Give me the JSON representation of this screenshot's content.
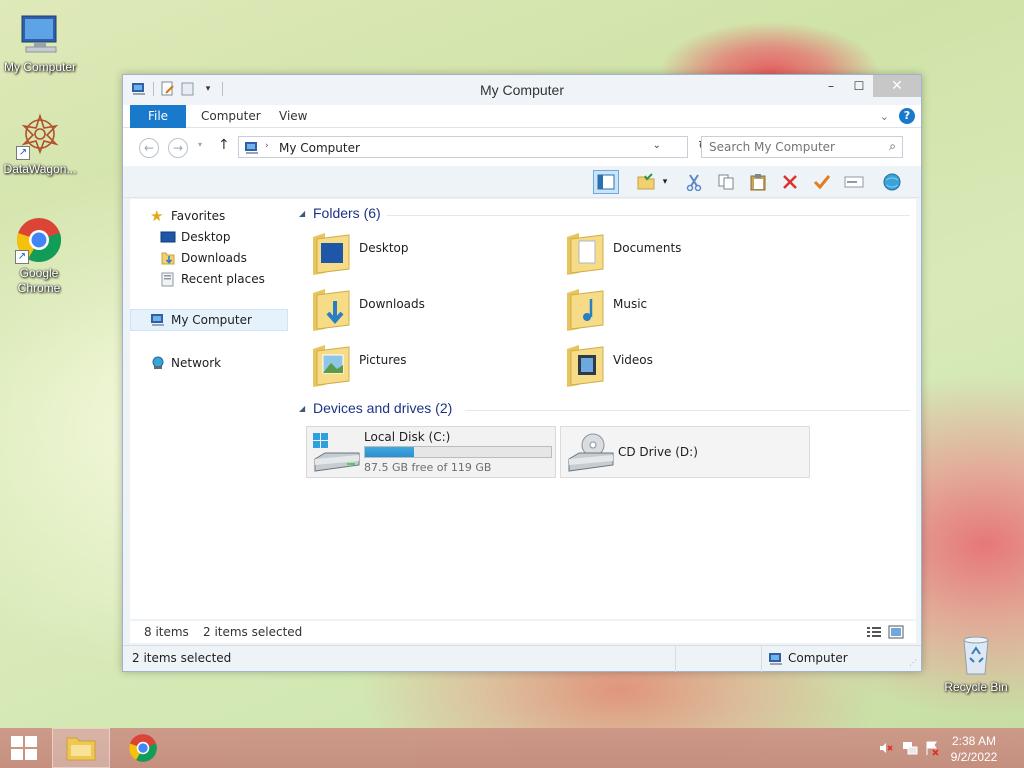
{
  "desktop": {
    "icons": [
      {
        "label": "My Computer"
      },
      {
        "label": "DataWagon..."
      },
      {
        "label": "Google Chrome"
      },
      {
        "label": "Recycle Bin"
      }
    ]
  },
  "window": {
    "title": "My Computer",
    "ribbon_tabs": [
      "File",
      "Computer",
      "View"
    ],
    "address": "My Computer",
    "search_placeholder": "Search My Computer",
    "close_glyph": "✕",
    "maximize_glyph": "☐",
    "minimize_glyph": "–"
  },
  "nav_pane": {
    "favorites": "Favorites",
    "favorites_items": [
      "Desktop",
      "Downloads",
      "Recent places"
    ],
    "my_computer": "My Computer",
    "network": "Network"
  },
  "main": {
    "folders_header": "Folders (6)",
    "folders": [
      "Desktop",
      "Documents",
      "Downloads",
      "Music",
      "Pictures",
      "Videos"
    ],
    "devices_header": "Devices and drives (2)",
    "drives": [
      {
        "name": "Local Disk (C:)",
        "free_text": "87.5 GB free of 119 GB",
        "used_fraction": 0.265
      },
      {
        "name": "CD Drive (D:)"
      }
    ]
  },
  "status": {
    "item_count": "8 items",
    "selected_inline": "2 items selected",
    "selected_bar": "2 items selected",
    "location": "Computer"
  },
  "taskbar": {
    "time": "2:38 AM",
    "date": "9/2/2022"
  },
  "colors": {
    "accent": "#1979ca",
    "group_header": "#1e3287",
    "drive_bar": "#2a8fd0"
  }
}
